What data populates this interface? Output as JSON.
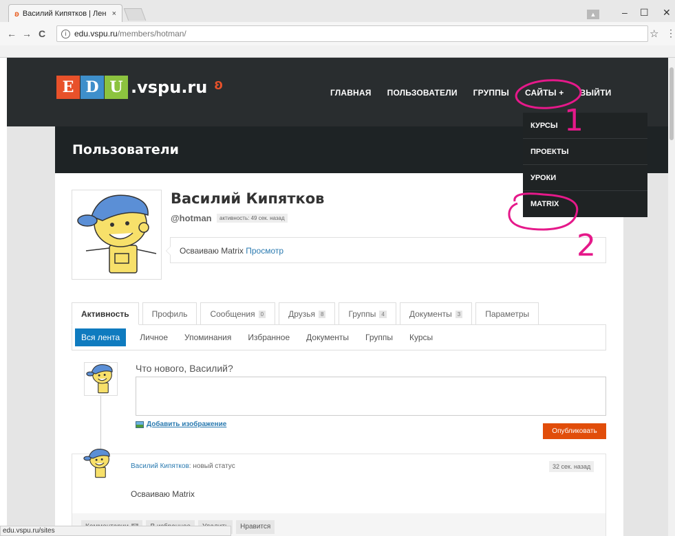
{
  "browser": {
    "tab_title": "Василий Кипятков | Лен",
    "tab_close": "×",
    "url_host": "edu.vspu.ru",
    "url_path": "/members/hotman/",
    "back": "←",
    "forward": "→",
    "reload": "C",
    "info": "i",
    "star": "☆",
    "menu": "⋮",
    "minimize": "–",
    "maximize": "☐",
    "close": "✕",
    "status_url": "edu.vspu.ru/sites"
  },
  "site": {
    "logo_letters": [
      "E",
      "D",
      "U"
    ],
    "logo_domain": ".vspu.ru",
    "nav": [
      {
        "label": "ГЛАВНАЯ"
      },
      {
        "label": "ПОЛЬЗОВАТЕЛИ"
      },
      {
        "label": "ГРУППЫ"
      },
      {
        "label": "САЙТЫ +"
      },
      {
        "label": "ВЫЙТИ"
      }
    ],
    "dropdown": [
      {
        "label": "КУРСЫ"
      },
      {
        "label": "ПРОЕКТЫ"
      },
      {
        "label": "УРОКИ"
      },
      {
        "label": "MATRIX"
      }
    ],
    "page_title": "Пользователи"
  },
  "profile": {
    "name": "Василий Кипятков",
    "handle": "@hotman",
    "activity": "активность: 49 сек. назад",
    "status_text": "Осваиваю Matrix",
    "status_link": "Просмотр"
  },
  "tabs": [
    {
      "label": "Активность",
      "count": ""
    },
    {
      "label": "Профиль",
      "count": ""
    },
    {
      "label": "Сообщения",
      "count": "0"
    },
    {
      "label": "Друзья",
      "count": "8"
    },
    {
      "label": "Группы",
      "count": "4"
    },
    {
      "label": "Документы",
      "count": "3"
    },
    {
      "label": "Параметры",
      "count": ""
    }
  ],
  "subnav": [
    {
      "label": "Вся лента"
    },
    {
      "label": "Личное"
    },
    {
      "label": "Упоминания"
    },
    {
      "label": "Избранное"
    },
    {
      "label": "Документы"
    },
    {
      "label": "Группы"
    },
    {
      "label": "Курсы"
    }
  ],
  "post_form": {
    "prompt": "Что нового, Василий?",
    "add_image": "Добавить изображение",
    "publish": "Опубликовать"
  },
  "activity_item": {
    "author": "Василий Кипятков",
    "action": ": новый статус",
    "time": "32 сек. назад",
    "body": "Осваиваю Matrix",
    "comments_label": "Комментарии",
    "comments_count": "0",
    "favorite_label": "В избранное",
    "delete_label": "Удалить",
    "like_label": "Нравится"
  },
  "annotations": {
    "one": "1",
    "two": "2",
    "color": "#e5198a"
  },
  "colors": {
    "header_bg": "#292d2f",
    "accent_blue": "#0f7bbf",
    "publish_orange": "#e14d0a"
  }
}
